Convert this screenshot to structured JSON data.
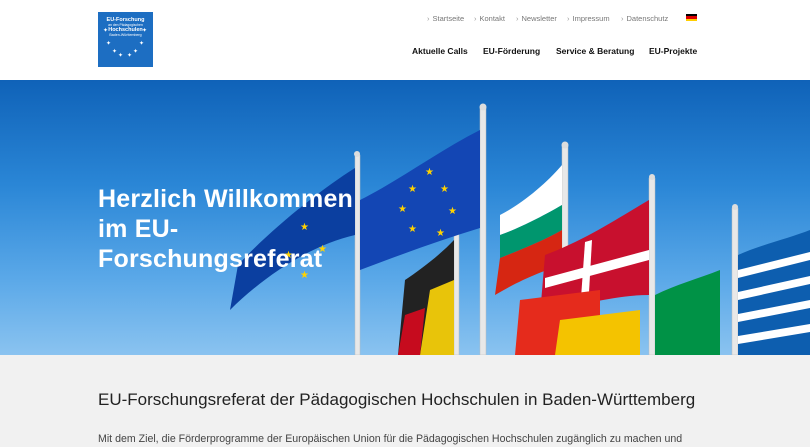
{
  "logo": {
    "line1": "EU-Forschung",
    "line2": "an den Pädagogischen",
    "line3": "Hochschulen",
    "line4": "Baden-Württemberg"
  },
  "topnav": {
    "items": [
      "Startseite",
      "Kontakt",
      "Newsletter",
      "Impressum",
      "Datenschutz"
    ],
    "chevron": "›",
    "language_flag": "german-flag"
  },
  "mainnav": {
    "items": [
      "Aktuelle Calls",
      "EU-Förderung",
      "Service & Beratung",
      "EU-Projekte"
    ]
  },
  "hero": {
    "line1": "Herzlich Willkommen",
    "line2": "im EU-",
    "line3": "Forschungsreferat"
  },
  "content": {
    "heading": "EU-Forschungsreferat der Pädagogischen Hochschulen in Baden-Württemberg",
    "intro": "Mit dem Ziel, die Förderprogramme der Europäischen Union für die Pädagogischen Hochschulen zugänglich zu machen und"
  },
  "colors": {
    "brand": "#1d6ec2",
    "hero_sky": "#2a86d6",
    "content_bg": "#f1f1f1"
  }
}
